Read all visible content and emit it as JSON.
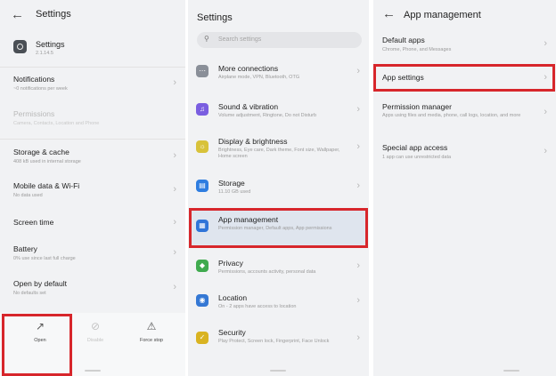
{
  "panel1": {
    "title": "Settings",
    "app": {
      "name": "Settings",
      "version": "2.1.14.5"
    },
    "items": [
      {
        "label": "Notifications",
        "sub": "~0 notifications per week"
      },
      {
        "label": "Permissions",
        "sub": "Camera, Contacts, Location and Phone"
      },
      {
        "label": "Storage & cache",
        "sub": "408 kB used in internal storage"
      },
      {
        "label": "Mobile data & Wi-Fi",
        "sub": "No data used"
      },
      {
        "label": "Screen time",
        "sub": ""
      },
      {
        "label": "Battery",
        "sub": "0% use since last full charge"
      },
      {
        "label": "Open by default",
        "sub": "No defaults set"
      }
    ],
    "bottom": {
      "open": "Open",
      "disable": "Disable",
      "force_stop": "Force stop"
    }
  },
  "panel2": {
    "title": "Settings",
    "search_placeholder": "Search settings",
    "items": [
      {
        "label": "More connections",
        "sub": "Airplane mode, VPN, Bluetooth, OTG",
        "icon": "more-connections-icon",
        "color": "#8a8f98"
      },
      {
        "label": "Sound & vibration",
        "sub": "Volume adjustment, Ringtone, Do not Disturb",
        "icon": "sound-icon",
        "color": "#7a5ee0"
      },
      {
        "label": "Display & brightness",
        "sub": "Brightness, Eye care, Dark theme, Font size, Wallpaper, Home screen",
        "icon": "display-icon",
        "color": "#d8c23a"
      },
      {
        "label": "Storage",
        "sub": "11.10 GB used",
        "icon": "storage-icon",
        "color": "#2e7de0"
      },
      {
        "label": "App management",
        "sub": "Permission manager, Default apps, App permissions",
        "icon": "apps-icon",
        "color": "#2f74d8"
      },
      {
        "label": "Privacy",
        "sub": "Permissions, accounts activity, personal data",
        "icon": "privacy-icon",
        "color": "#3faa4e"
      },
      {
        "label": "Location",
        "sub": "On - 2 apps have access to location",
        "icon": "location-icon",
        "color": "#3578d4"
      },
      {
        "label": "Security",
        "sub": "Play Protect, Screen lock, Fingerprint, Face Unlock",
        "icon": "security-icon",
        "color": "#d9b321"
      }
    ]
  },
  "panel3": {
    "title": "App management",
    "items": [
      {
        "label": "Default apps",
        "sub": "Chrome, Phone, and Messages"
      },
      {
        "label": "App settings",
        "sub": ""
      },
      {
        "label": "Permission manager",
        "sub": "Apps using files and media, phone, call logs, location, and more"
      },
      {
        "label": "Special app access",
        "sub": "1 app can use unrestricted data"
      }
    ]
  },
  "colors": {
    "highlight": "#d7262b"
  }
}
